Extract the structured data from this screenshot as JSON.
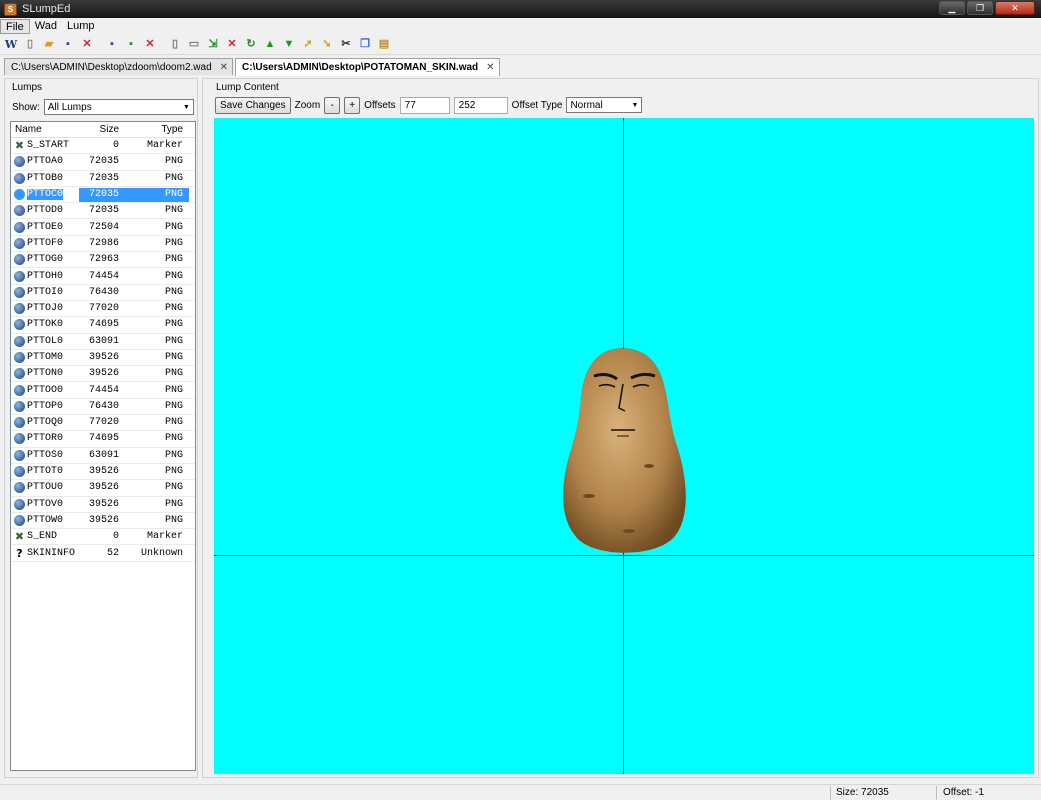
{
  "window": {
    "title": "SLumpEd"
  },
  "menu": {
    "items": [
      "File",
      "Wad",
      "Lump"
    ]
  },
  "tabs": [
    {
      "label": "C:\\Users\\ADMIN\\Desktop\\zdoom\\doom2.wad",
      "active": false
    },
    {
      "label": "C:\\Users\\ADMIN\\Desktop\\POTATOMAN_SKIN.wad",
      "active": true
    }
  ],
  "lumps_panel": {
    "title": "Lumps",
    "show_label": "Show:",
    "show_value": "All Lumps",
    "columns": {
      "name": "Name",
      "size": "Size",
      "type": "Type"
    },
    "selected_index": 3,
    "rows": [
      {
        "name": "S_START",
        "size": "0",
        "type": "Marker",
        "icon": "marker-icon"
      },
      {
        "name": "PTTOA0",
        "size": "72035",
        "type": "PNG",
        "icon": "png-icon"
      },
      {
        "name": "PTTOB0",
        "size": "72035",
        "type": "PNG",
        "icon": "png-icon"
      },
      {
        "name": "PTTOC0",
        "size": "72035",
        "type": "PNG",
        "icon": "png-icon"
      },
      {
        "name": "PTTOD0",
        "size": "72035",
        "type": "PNG",
        "icon": "png-icon"
      },
      {
        "name": "PTTOE0",
        "size": "72504",
        "type": "PNG",
        "icon": "png-icon"
      },
      {
        "name": "PTTOF0",
        "size": "72986",
        "type": "PNG",
        "icon": "png-icon"
      },
      {
        "name": "PTTOG0",
        "size": "72963",
        "type": "PNG",
        "icon": "png-icon"
      },
      {
        "name": "PTTOH0",
        "size": "74454",
        "type": "PNG",
        "icon": "png-icon"
      },
      {
        "name": "PTTOI0",
        "size": "76430",
        "type": "PNG",
        "icon": "png-icon"
      },
      {
        "name": "PTTOJ0",
        "size": "77020",
        "type": "PNG",
        "icon": "png-icon"
      },
      {
        "name": "PTTOK0",
        "size": "74695",
        "type": "PNG",
        "icon": "png-icon"
      },
      {
        "name": "PTTOL0",
        "size": "63091",
        "type": "PNG",
        "icon": "png-icon"
      },
      {
        "name": "PTTOM0",
        "size": "39526",
        "type": "PNG",
        "icon": "png-icon"
      },
      {
        "name": "PTTON0",
        "size": "39526",
        "type": "PNG",
        "icon": "png-icon"
      },
      {
        "name": "PTTOO0",
        "size": "74454",
        "type": "PNG",
        "icon": "png-icon"
      },
      {
        "name": "PTTOP0",
        "size": "76430",
        "type": "PNG",
        "icon": "png-icon"
      },
      {
        "name": "PTTOQ0",
        "size": "77020",
        "type": "PNG",
        "icon": "png-icon"
      },
      {
        "name": "PTTOR0",
        "size": "74695",
        "type": "PNG",
        "icon": "png-icon"
      },
      {
        "name": "PTTOS0",
        "size": "63091",
        "type": "PNG",
        "icon": "png-icon"
      },
      {
        "name": "PTTOT0",
        "size": "39526",
        "type": "PNG",
        "icon": "png-icon"
      },
      {
        "name": "PTTOU0",
        "size": "39526",
        "type": "PNG",
        "icon": "png-icon"
      },
      {
        "name": "PTTOV0",
        "size": "39526",
        "type": "PNG",
        "icon": "png-icon"
      },
      {
        "name": "PTTOW0",
        "size": "39526",
        "type": "PNG",
        "icon": "png-icon"
      },
      {
        "name": "S_END",
        "size": "0",
        "type": "Marker",
        "icon": "marker-icon"
      },
      {
        "name": "SKININFO",
        "size": "52",
        "type": "Unknown",
        "icon": "unknown-icon"
      }
    ]
  },
  "content_panel": {
    "title": "Lump Content",
    "save_label": "Save Changes",
    "zoom_label": "Zoom",
    "zoom_out_label": "-",
    "zoom_in_label": "+",
    "offsets_label": "Offsets",
    "offset_x": "77",
    "offset_y": "252",
    "offset_type_label": "Offset Type",
    "offset_type_value": "Normal",
    "canvas_color": "#00ffff"
  },
  "status": {
    "size": "Size: 72035",
    "offset": "Offset: -1"
  }
}
